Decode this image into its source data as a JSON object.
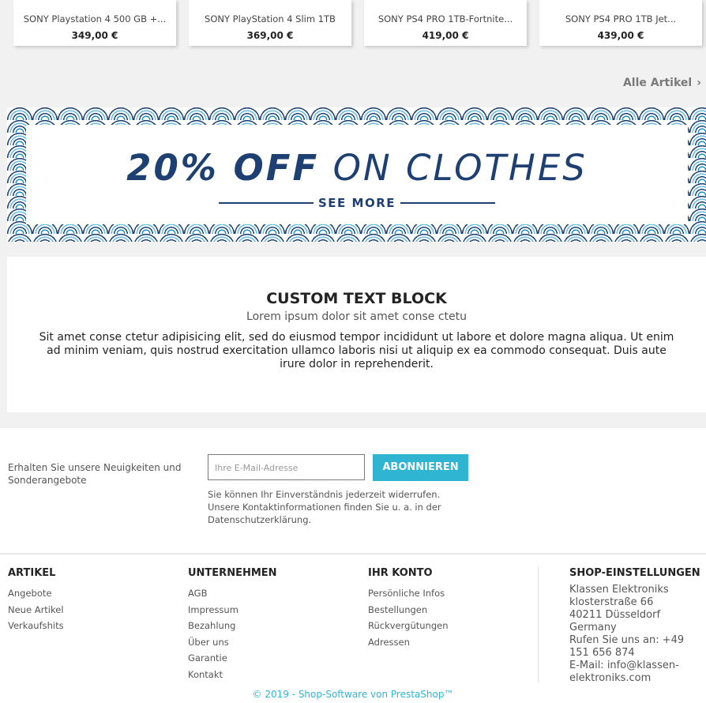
{
  "products": [
    {
      "name": "SONY Playstation 4 500 GB +...",
      "price": "349,00 €"
    },
    {
      "name": "SONY PlayStation 4 Slim 1TB",
      "price": "369,00 €"
    },
    {
      "name": "SONY PS4 PRO 1TB-Fortnite...",
      "price": "419,00 €"
    },
    {
      "name": "SONY PS4 PRO 1TB Jet...",
      "price": "439,00 €"
    }
  ],
  "all_link": "Alle Artikel",
  "banner": {
    "bold": "20% OFF",
    "rest": "ON CLOTHES",
    "see_more": "SEE MORE"
  },
  "textblock": {
    "title": "CUSTOM TEXT BLOCK",
    "subtitle": "Lorem ipsum dolor sit amet conse ctetu",
    "body": "Sit amet conse ctetur adipisicing elit, sed do eiusmod tempor incididunt ut labore et dolore magna aliqua. Ut enim ad minim veniam, quis nostrud exercitation ullamco laboris nisi ut aliquip ex ea commodo consequat. Duis aute irure dolor in reprehenderit."
  },
  "newsletter": {
    "label": "Erhalten Sie unsere Neuigkeiten und Sonderangebote",
    "placeholder": "Ihre E-Mail-Adresse",
    "button": "ABONNIEREN",
    "note": "Sie können Ihr Einverständnis jederzeit widerrufen. Unsere Kontaktinformationen finden Sie u. a. in der Datenschutzerklärung."
  },
  "footer": {
    "artikel": {
      "title": "ARTIKEL",
      "items": [
        "Angebote",
        "Neue Artikel",
        "Verkaufshits"
      ]
    },
    "unternehmen": {
      "title": "UNTERNEHMEN",
      "items": [
        "AGB",
        "Impressum",
        "Bezahlung",
        "Über uns",
        "Garantie",
        "Kontakt"
      ]
    },
    "konto": {
      "title": "IHR KONTO",
      "items": [
        "Persönliche Infos",
        "Bestellungen",
        "Rückvergütungen",
        "Adressen"
      ]
    },
    "shop": {
      "title": "SHOP-EINSTELLUNGEN",
      "lines": [
        "Klassen Elektroniks",
        "klosterstraße 66",
        "40211 Düsseldorf",
        "Germany",
        "Rufen Sie uns an: +49 151 656 874",
        "E-Mail: info@klassen-elektroniks.com"
      ]
    },
    "copyright": "© 2019 - Shop-Software von PrestaShop™"
  },
  "colors": {
    "accent": "#2fb5d2",
    "banner_navy": "#1d3f72"
  }
}
